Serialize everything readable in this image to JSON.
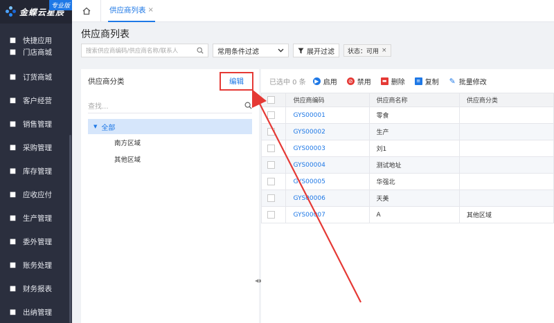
{
  "sidebar": {
    "logo_text": "金蝶云星辰",
    "logo_badge": "专业版",
    "items": [
      {
        "label": "快捷应用",
        "icon": "grid-icon"
      },
      {
        "label": "门店商城",
        "icon": "store-icon"
      },
      {
        "label": "订货商城",
        "icon": "order-icon"
      },
      {
        "label": "客户经营",
        "icon": "customer-icon"
      },
      {
        "label": "销售管理",
        "icon": "sales-icon"
      },
      {
        "label": "采购管理",
        "icon": "cart-icon"
      },
      {
        "label": "库存管理",
        "icon": "box-icon"
      },
      {
        "label": "应收应付",
        "icon": "money-icon"
      },
      {
        "label": "生产管理",
        "icon": "factory-icon"
      },
      {
        "label": "委外管理",
        "icon": "outsource-icon"
      },
      {
        "label": "账务处理",
        "icon": "ledger-icon"
      },
      {
        "label": "财务报表",
        "icon": "report-icon"
      },
      {
        "label": "出纳管理",
        "icon": "cashier-icon"
      }
    ]
  },
  "tabs": {
    "active_tab": "供应商列表"
  },
  "page": {
    "title": "供应商列表"
  },
  "filter": {
    "search_placeholder": "搜索供应商编码/供应商名称/联系人",
    "scheme_select": "常用条件过滤",
    "expand_button": "展开过滤",
    "chip": "状态：可用"
  },
  "left_panel": {
    "title": "供应商分类",
    "edit_button": "编辑",
    "search_placeholder": "查找...",
    "tree_root": "全部",
    "tree_children": [
      "南方区域",
      "其他区域"
    ]
  },
  "toolbar": {
    "selected_count": "已选中 0 条",
    "enable": "启用",
    "disable": "禁用",
    "delete": "删除",
    "copy": "复制",
    "batch_edit": "批量修改"
  },
  "table": {
    "headers": [
      "供应商编码",
      "供应商名称",
      "供应商分类"
    ],
    "rows": [
      {
        "code": "GYS00001",
        "name": "零食",
        "category": ""
      },
      {
        "code": "GYS00002",
        "name": "生产",
        "category": ""
      },
      {
        "code": "GYS00003",
        "name": "刘1",
        "category": ""
      },
      {
        "code": "GYS00004",
        "name": "测试地址",
        "category": ""
      },
      {
        "code": "GYS00005",
        "name": "华强北",
        "category": ""
      },
      {
        "code": "GYS00006",
        "name": "天美",
        "category": ""
      },
      {
        "code": "GYS00007",
        "name": "A",
        "category": "其他区域"
      }
    ]
  },
  "colors": {
    "accent": "#1e78e6",
    "sidebar_bg": "#2b2f3e",
    "annotation": "#e53935"
  }
}
